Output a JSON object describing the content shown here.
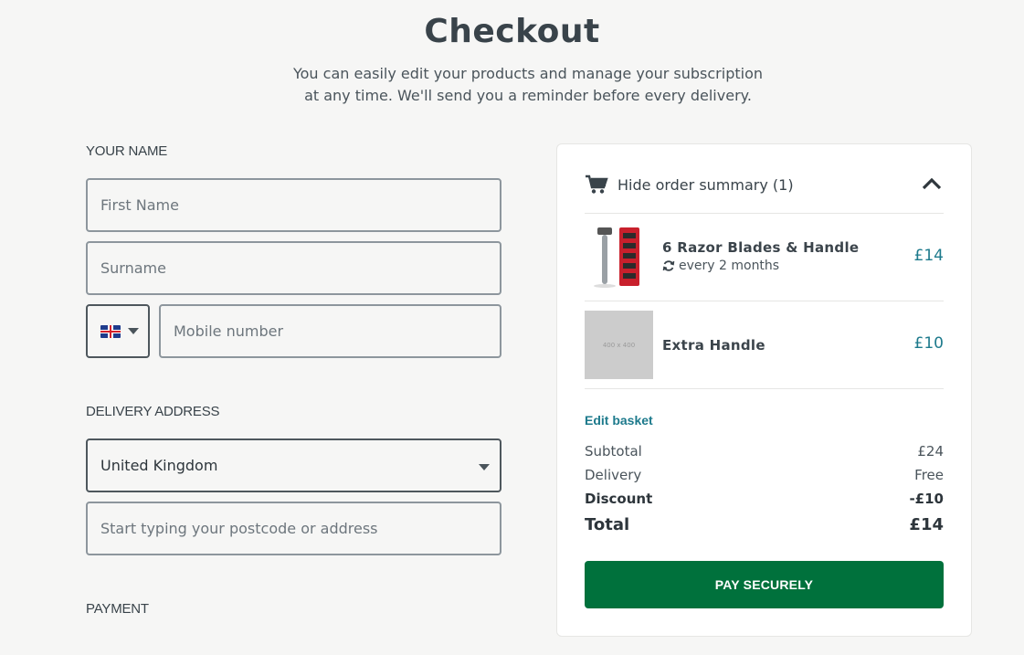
{
  "header": {
    "title": "Checkout",
    "subtitle_line1": "You can easily edit your products and manage your subscription",
    "subtitle_line2": "at any time. We'll send you a reminder before every delivery."
  },
  "form": {
    "name_section": "YOUR NAME",
    "first_name_placeholder": "First Name",
    "surname_placeholder": "Surname",
    "mobile_placeholder": "Mobile number",
    "country_code_icon": "uk-flag-icon",
    "address_section": "DELIVERY ADDRESS",
    "country_value": "United Kingdom",
    "address_placeholder": "Start typing your postcode or address",
    "payment_section": "PAYMENT"
  },
  "summary": {
    "toggle_label": "Hide order summary (1)",
    "items": [
      {
        "name": "6 Razor Blades & Handle",
        "frequency": "every 2 months",
        "price": "£14"
      },
      {
        "name": "Extra Handle",
        "image_placeholder": "400 x 400",
        "price": "£10"
      }
    ],
    "edit_basket": "Edit basket",
    "subtotal_label": "Subtotal",
    "subtotal_value": "£24",
    "delivery_label": "Delivery",
    "delivery_value": "Free",
    "discount_label": "Discount",
    "discount_value": "-£10",
    "total_label": "Total",
    "total_value": "£14",
    "pay_button": "PAY SECURELY"
  },
  "colors": {
    "accent": "#1d7a8c",
    "pay_button": "#00713c"
  }
}
